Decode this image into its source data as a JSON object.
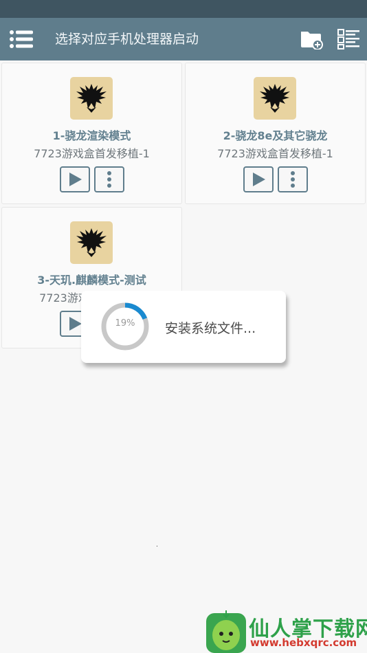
{
  "appbar": {
    "title": "选择对应手机处理器启动"
  },
  "icons": {
    "menu": "hamburger-menu-icon",
    "folder": "folder-add-icon",
    "list": "list-settings-icon",
    "play": "play-icon",
    "more": "more-vertical-icon",
    "emblem": "eagle-emblem-icon"
  },
  "cards": [
    {
      "title": "1-骁龙渲染模式",
      "subtitle": "7723游戏盒首发移植-1"
    },
    {
      "title": "2-骁龙8e及其它骁龙",
      "subtitle": "7723游戏盒首发移植-1"
    },
    {
      "title": "3-天玑.麒麟模式-测试",
      "subtitle": "7723游戏盒首发移植"
    }
  ],
  "dialog": {
    "progress": "19%",
    "progress_value": 0.19,
    "message": "安装系统文件..."
  },
  "watermark": {
    "text": "仙人掌下载网",
    "url": "www.hebxqrc.com"
  },
  "colors": {
    "statusbar": "#3f5561",
    "appbar": "#5f7d8c",
    "accent": "#1a8ad0",
    "title": "#62808f"
  }
}
